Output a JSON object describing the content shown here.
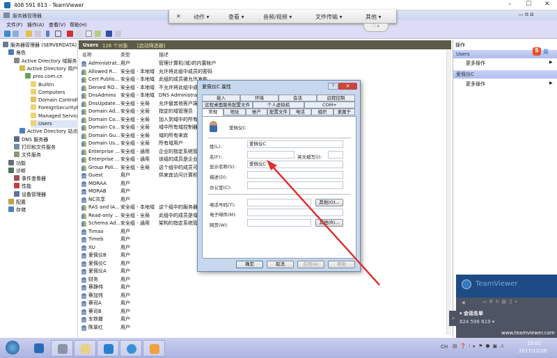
{
  "teamviewer": {
    "title": "408 591 813 - TeamViewer",
    "toolbar": {
      "close": "✕",
      "actions": "动作 ▾",
      "view": "查看 ▾",
      "audio_video": "音频/视频 ▾",
      "file_transfer": "文件传输 ▾",
      "other": "其他 ▾",
      "tab": "⛶ ∧"
    },
    "panel": {
      "brand": "TeamViewer",
      "session_list": "▾ 会话名单",
      "session_id": "824 596 619 ▾",
      "url": "www.teamviewer.com",
      "close": "✕",
      "expand": "›"
    }
  },
  "window": {
    "title": "服务器管理器",
    "menu": [
      "文件(F)",
      "操作(A)",
      "查看(V)",
      "帮助(H)"
    ]
  },
  "tree": [
    {
      "label": "服务器管理器 (SERVERDATA)",
      "level": 0,
      "color": "#6a7a90"
    },
    {
      "label": "角色",
      "level": 1,
      "color": "#4a78b8"
    },
    {
      "label": "Active Directory 域服务",
      "level": 2,
      "color": "#888"
    },
    {
      "label": "Active Directory 用户和计算机",
      "level": 3,
      "color": "#d8b84a"
    },
    {
      "label": "pros.com.cn",
      "level": 4,
      "color": "#6aa060"
    },
    {
      "label": "Builtin",
      "level": 5,
      "color": "#f0d070"
    },
    {
      "label": "Computers",
      "level": 5,
      "color": "#f0d070"
    },
    {
      "label": "Domain Controllers",
      "level": 5,
      "color": "#e0c060"
    },
    {
      "label": "ForeignSecurityPrincipals",
      "level": 5,
      "color": "#f0d070"
    },
    {
      "label": "Managed Service Accounts",
      "level": 5,
      "color": "#f0d070"
    },
    {
      "label": "Users",
      "level": 5,
      "color": "#f0d070",
      "selected": true
    },
    {
      "label": "Active Directory 站点和服务",
      "level": 3,
      "color": "#4a80c0"
    },
    {
      "label": "DNS 服务器",
      "level": 2,
      "color": "#5a6a8a"
    },
    {
      "label": "打印和文件服务",
      "level": 2,
      "color": "#7a8aa0"
    },
    {
      "label": "文件服务",
      "level": 2,
      "color": "#8a9a70"
    },
    {
      "label": "功能",
      "level": 1,
      "color": "#607080"
    },
    {
      "label": "诊断",
      "level": 1,
      "color": "#507050"
    },
    {
      "label": "事件查看器",
      "level": 2,
      "color": "#a05050"
    },
    {
      "label": "性能",
      "level": 2,
      "color": "#c04040"
    },
    {
      "label": "设备管理器",
      "level": 2,
      "color": "#6070a0"
    },
    {
      "label": "配置",
      "level": 1,
      "color": "#c0a040"
    },
    {
      "label": "存储",
      "level": 1,
      "color": "#5080c0"
    }
  ],
  "list": {
    "header_title": "Users",
    "header_count": "126 个对象",
    "header_filter": "[启动筛选器]",
    "columns": [
      "名称",
      "类型",
      "描述"
    ],
    "rows": [
      {
        "name": "Administrat...",
        "type": "用户",
        "desc": "管理计算机(域)的内置帐户",
        "group": false
      },
      {
        "name": "Allowed R...",
        "type": "安全组 - 本地域",
        "desc": "允许将此组中成员的密码",
        "group": true
      },
      {
        "name": "Cert Publis...",
        "type": "安全组 - 本地域",
        "desc": "此组的成员被允许发布",
        "group": true
      },
      {
        "name": "Denied RO...",
        "type": "安全组 - 本地域",
        "desc": "不允许将此组中成员",
        "group": true
      },
      {
        "name": "DnsAdmins",
        "type": "安全组 - 本地域",
        "desc": "DNS Administrators",
        "group": true
      },
      {
        "name": "DnsUpdate...",
        "type": "安全组 - 全局",
        "desc": "允许替其他客户端",
        "group": true
      },
      {
        "name": "Domain Ad...",
        "type": "安全组 - 全局",
        "desc": "指定的域管理员",
        "group": true
      },
      {
        "name": "Domain Co...",
        "type": "安全组 - 全局",
        "desc": "加入到域中的所有",
        "group": true
      },
      {
        "name": "Domain Co...",
        "type": "安全组 - 全局",
        "desc": "域中所有域控制器",
        "group": true
      },
      {
        "name": "Domain Gu...",
        "type": "安全组 - 全局",
        "desc": "域的所有来宾",
        "group": true
      },
      {
        "name": "Domain Us...",
        "type": "安全组 - 全局",
        "desc": "所有域用户",
        "group": true
      },
      {
        "name": "Enterprise ...",
        "type": "安全组 - 通用",
        "desc": "企业的指定系统管",
        "group": true
      },
      {
        "name": "Enterprise ...",
        "type": "安全组 - 通用",
        "desc": "该组的成员是企业",
        "group": true
      },
      {
        "name": "Group Poli...",
        "type": "安全组 - 全局",
        "desc": "这个组中的成员可",
        "group": true
      },
      {
        "name": "Guest",
        "type": "用户",
        "desc": "供来宾访问计算机",
        "group": false
      },
      {
        "name": "MORAA",
        "type": "用户",
        "desc": "",
        "group": false
      },
      {
        "name": "MORAB",
        "type": "用户",
        "desc": "",
        "group": false
      },
      {
        "name": "NC共享",
        "type": "用户",
        "desc": "",
        "group": false
      },
      {
        "name": "RAS and IA...",
        "type": "安全组 - 本地域",
        "desc": "这个组中的服务器",
        "group": true
      },
      {
        "name": "Read-only ...",
        "type": "安全组 - 全局",
        "desc": "此组中的成员是域",
        "group": true
      },
      {
        "name": "Schema Ad...",
        "type": "安全组 - 通用",
        "desc": "架构的指定系统管",
        "group": true
      },
      {
        "name": "Timaa",
        "type": "用户",
        "desc": "",
        "group": false
      },
      {
        "name": "Timeb",
        "type": "用户",
        "desc": "",
        "group": false
      },
      {
        "name": "XU",
        "type": "用户",
        "desc": "",
        "group": false
      },
      {
        "name": "爱佩仪B",
        "type": "用户",
        "desc": "",
        "group": false
      },
      {
        "name": "爱佩仪C",
        "type": "用户",
        "desc": "",
        "group": false
      },
      {
        "name": "爱佩仪A",
        "type": "用户",
        "desc": "",
        "group": false
      },
      {
        "name": "财务",
        "type": "用户",
        "desc": "",
        "group": false
      },
      {
        "name": "蔡静伟",
        "type": "用户",
        "desc": "",
        "group": false
      },
      {
        "name": "蔡加伟",
        "type": "用户",
        "desc": "",
        "group": false
      },
      {
        "name": "蔡司A",
        "type": "用户",
        "desc": "",
        "group": false
      },
      {
        "name": "蔡司B",
        "type": "用户",
        "desc": "",
        "group": false
      },
      {
        "name": "车铁磐",
        "type": "用户",
        "desc": "",
        "group": false
      },
      {
        "name": "陈翠红",
        "type": "用户",
        "desc": "",
        "group": false
      }
    ]
  },
  "actions": {
    "title": "操作",
    "sections": [
      {
        "title": "Users",
        "item": "更多操作"
      },
      {
        "title": "爱佩仪C",
        "item": "更多操作"
      }
    ],
    "ime": "英"
  },
  "dialog": {
    "title": "爱佩仪C 属性",
    "help": "?",
    "close": "✕",
    "tabs_row1": [
      "拨入",
      "环境",
      "会话",
      "远程控制"
    ],
    "tabs_row2": [
      "远程桌面服务配置文件",
      "个人虚拟机",
      "COM+"
    ],
    "tabs_row3": [
      "常规",
      "地址",
      "帐户",
      "配置文件",
      "电话",
      "组织",
      "隶属于"
    ],
    "user_name": "爱佩仪C",
    "fields": {
      "last_name_label": "姓(L):",
      "last_name": "爱佩仪C",
      "first_name_label": "名(F):",
      "first_name": "",
      "initials_label": "英文缩写(I):",
      "initials": "",
      "display_label": "显示名称(S):",
      "display": "爱佩仪C",
      "desc_label": "描述(D):",
      "desc": "",
      "office_label": "办公室(C):",
      "office": "",
      "phone_label": "电话号码(T):",
      "phone": "",
      "email_label": "电子邮件(M):",
      "email": "",
      "web_label": "网页(W):",
      "web": ""
    },
    "other_phone": "其他(O)...",
    "other_web": "其他(R)...",
    "buttons": {
      "ok": "确定",
      "cancel": "取消",
      "apply": "应用(A)",
      "help": "帮助"
    }
  },
  "taskbar": {
    "time": "15:01",
    "date": "2017/12/28",
    "lang": "CH"
  },
  "colors": {
    "header_bar": "#5c5b48",
    "annotation_arrow": "#e03030",
    "taskbar": "#aab3e0"
  }
}
